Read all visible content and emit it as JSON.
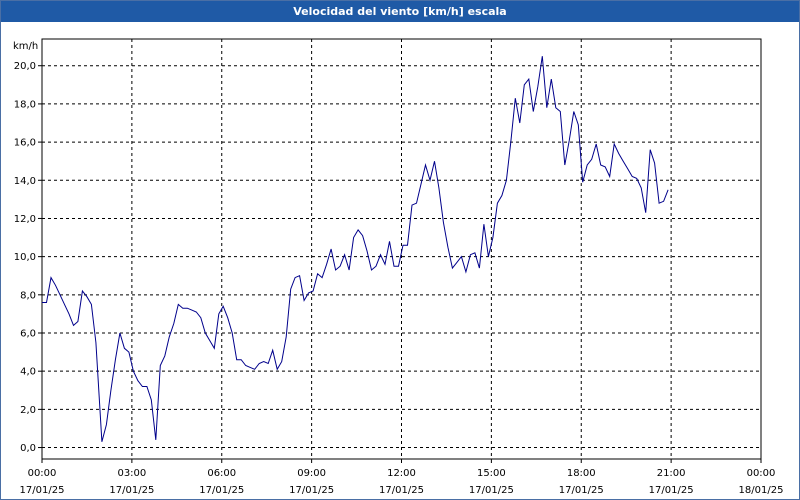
{
  "window": {
    "title": "Velocidad del viento [km/h] escala"
  },
  "chart_data": {
    "type": "line",
    "title": "Velocidad del viento [km/h] escala",
    "ylabel": "km/h",
    "xlabel": "",
    "ylim": [
      -0.6,
      21.4
    ],
    "xlim": [
      0,
      24
    ],
    "grid": true,
    "line_color": "#00008b",
    "grid_color": "#000000",
    "y_ticks": [
      0,
      2,
      4,
      6,
      8,
      10,
      12,
      14,
      16,
      18,
      20
    ],
    "y_tick_labels": [
      "0,0",
      "2,0",
      "4,0",
      "6,0",
      "8,0",
      "10,0",
      "12,0",
      "14,0",
      "16,0",
      "18,0",
      "20,0"
    ],
    "x_ticks": [
      0,
      3,
      6,
      9,
      12,
      15,
      18,
      21,
      24
    ],
    "x_tick_labels": [
      {
        "time": "00:00",
        "date": "17/01/25"
      },
      {
        "time": "03:00",
        "date": "17/01/25"
      },
      {
        "time": "06:00",
        "date": "17/01/25"
      },
      {
        "time": "09:00",
        "date": "17/01/25"
      },
      {
        "time": "12:00",
        "date": "17/01/25"
      },
      {
        "time": "15:00",
        "date": "17/01/25"
      },
      {
        "time": "18:00",
        "date": "17/01/25"
      },
      {
        "time": "21:00",
        "date": "17/01/25"
      },
      {
        "time": "00:00",
        "date": "18/01/25"
      }
    ],
    "series": [
      {
        "values": [
          [
            0.0,
            7.6
          ],
          [
            0.15,
            7.6
          ],
          [
            0.3,
            8.9
          ],
          [
            0.45,
            8.5
          ],
          [
            0.6,
            8.0
          ],
          [
            0.75,
            7.5
          ],
          [
            0.9,
            7.0
          ],
          [
            1.05,
            6.4
          ],
          [
            1.2,
            6.6
          ],
          [
            1.35,
            8.2
          ],
          [
            1.5,
            7.9
          ],
          [
            1.65,
            7.5
          ],
          [
            1.8,
            5.5
          ],
          [
            2.0,
            0.3
          ],
          [
            2.15,
            1.2
          ],
          [
            2.3,
            3.0
          ],
          [
            2.45,
            4.6
          ],
          [
            2.6,
            6.0
          ],
          [
            2.75,
            5.2
          ],
          [
            2.9,
            5.0
          ],
          [
            3.05,
            4.0
          ],
          [
            3.2,
            3.5
          ],
          [
            3.35,
            3.2
          ],
          [
            3.5,
            3.2
          ],
          [
            3.65,
            2.5
          ],
          [
            3.8,
            0.4
          ],
          [
            3.95,
            4.3
          ],
          [
            4.1,
            4.8
          ],
          [
            4.25,
            5.8
          ],
          [
            4.4,
            6.5
          ],
          [
            4.55,
            7.5
          ],
          [
            4.7,
            7.3
          ],
          [
            4.85,
            7.3
          ],
          [
            5.0,
            7.2
          ],
          [
            5.15,
            7.1
          ],
          [
            5.3,
            6.8
          ],
          [
            5.45,
            6.0
          ],
          [
            5.6,
            5.6
          ],
          [
            5.75,
            5.2
          ],
          [
            5.9,
            7.0
          ],
          [
            6.05,
            7.4
          ],
          [
            6.2,
            6.8
          ],
          [
            6.35,
            6.0
          ],
          [
            6.5,
            4.6
          ],
          [
            6.65,
            4.6
          ],
          [
            6.8,
            4.3
          ],
          [
            6.95,
            4.2
          ],
          [
            7.1,
            4.1
          ],
          [
            7.25,
            4.4
          ],
          [
            7.4,
            4.5
          ],
          [
            7.55,
            4.4
          ],
          [
            7.7,
            5.1
          ],
          [
            7.85,
            4.1
          ],
          [
            8.0,
            4.5
          ],
          [
            8.15,
            5.8
          ],
          [
            8.3,
            8.3
          ],
          [
            8.45,
            8.9
          ],
          [
            8.6,
            9.0
          ],
          [
            8.75,
            7.7
          ],
          [
            8.9,
            8.1
          ],
          [
            9.05,
            8.2
          ],
          [
            9.2,
            9.1
          ],
          [
            9.35,
            8.9
          ],
          [
            9.5,
            9.6
          ],
          [
            9.65,
            10.4
          ],
          [
            9.8,
            9.3
          ],
          [
            9.95,
            9.5
          ],
          [
            10.1,
            10.1
          ],
          [
            10.25,
            9.3
          ],
          [
            10.4,
            11.0
          ],
          [
            10.55,
            11.4
          ],
          [
            10.7,
            11.1
          ],
          [
            10.85,
            10.3
          ],
          [
            11.0,
            9.3
          ],
          [
            11.15,
            9.5
          ],
          [
            11.3,
            10.1
          ],
          [
            11.45,
            9.6
          ],
          [
            11.6,
            10.8
          ],
          [
            11.75,
            9.5
          ],
          [
            11.9,
            9.5
          ],
          [
            12.05,
            10.6
          ],
          [
            12.2,
            10.6
          ],
          [
            12.35,
            12.7
          ],
          [
            12.5,
            12.8
          ],
          [
            12.65,
            13.8
          ],
          [
            12.8,
            14.8
          ],
          [
            12.95,
            14.0
          ],
          [
            13.1,
            15.0
          ],
          [
            13.25,
            13.6
          ],
          [
            13.4,
            11.8
          ],
          [
            13.55,
            10.5
          ],
          [
            13.7,
            9.4
          ],
          [
            13.85,
            9.7
          ],
          [
            14.0,
            10.0
          ],
          [
            14.15,
            9.2
          ],
          [
            14.3,
            10.1
          ],
          [
            14.45,
            10.2
          ],
          [
            14.6,
            9.4
          ],
          [
            14.75,
            11.7
          ],
          [
            14.9,
            10.0
          ],
          [
            15.05,
            11.0
          ],
          [
            15.2,
            12.8
          ],
          [
            15.35,
            13.2
          ],
          [
            15.5,
            14.0
          ],
          [
            15.65,
            16.0
          ],
          [
            15.8,
            18.3
          ],
          [
            15.95,
            17.0
          ],
          [
            16.1,
            19.0
          ],
          [
            16.25,
            19.3
          ],
          [
            16.4,
            17.6
          ],
          [
            16.55,
            18.9
          ],
          [
            16.7,
            20.5
          ],
          [
            16.85,
            17.8
          ],
          [
            17.0,
            19.3
          ],
          [
            17.15,
            17.8
          ],
          [
            17.3,
            17.6
          ],
          [
            17.45,
            14.8
          ],
          [
            17.6,
            16.1
          ],
          [
            17.75,
            17.6
          ],
          [
            17.9,
            16.9
          ],
          [
            18.05,
            13.9
          ],
          [
            18.2,
            14.8
          ],
          [
            18.35,
            15.1
          ],
          [
            18.5,
            15.9
          ],
          [
            18.65,
            14.8
          ],
          [
            18.8,
            14.7
          ],
          [
            18.95,
            14.2
          ],
          [
            19.1,
            15.9
          ],
          [
            19.25,
            15.4
          ],
          [
            19.4,
            15.0
          ],
          [
            19.55,
            14.6
          ],
          [
            19.7,
            14.2
          ],
          [
            19.85,
            14.1
          ],
          [
            20.0,
            13.6
          ],
          [
            20.15,
            12.3
          ],
          [
            20.3,
            15.6
          ],
          [
            20.45,
            14.9
          ],
          [
            20.6,
            12.8
          ],
          [
            20.75,
            12.9
          ],
          [
            20.9,
            13.5
          ]
        ]
      }
    ]
  }
}
